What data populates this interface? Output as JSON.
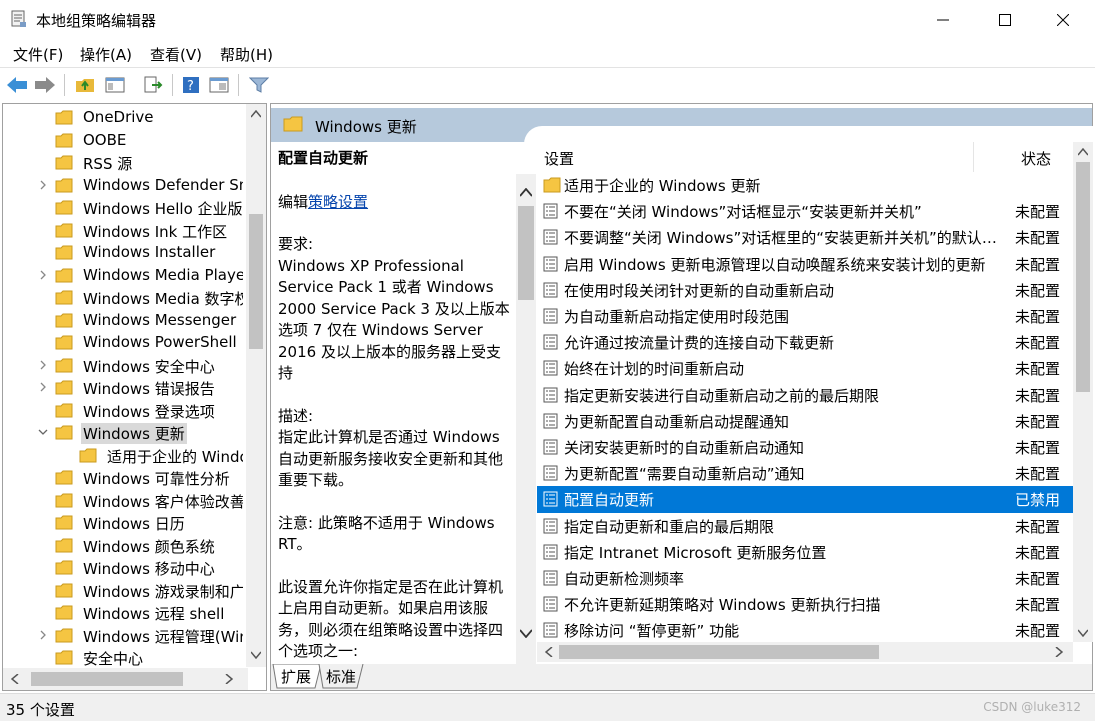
{
  "window": {
    "title": "本地组策略编辑器"
  },
  "menu": [
    "文件(F)",
    "操作(A)",
    "查看(V)",
    "帮助(H)"
  ],
  "toolbar": {
    "icons": [
      "back-icon",
      "forward-icon",
      "up-folder-icon",
      "show-hide-tree-icon",
      "export-list-icon",
      "help-icon",
      "properties-icon",
      "filter-icon"
    ]
  },
  "tree": {
    "items": [
      {
        "label": "OneDrive",
        "expandable": false,
        "indent": 0
      },
      {
        "label": "OOBE",
        "expandable": false,
        "indent": 0
      },
      {
        "label": "RSS 源",
        "expandable": false,
        "indent": 0
      },
      {
        "label": "Windows Defender SmartScreen",
        "expandable": true,
        "indent": 0
      },
      {
        "label": "Windows Hello 企业版",
        "expandable": false,
        "indent": 0
      },
      {
        "label": "Windows Ink 工作区",
        "expandable": false,
        "indent": 0
      },
      {
        "label": "Windows Installer",
        "expandable": false,
        "indent": 0
      },
      {
        "label": "Windows Media Player",
        "expandable": true,
        "indent": 0
      },
      {
        "label": "Windows Media 数字权限管理",
        "expandable": false,
        "indent": 0
      },
      {
        "label": "Windows Messenger",
        "expandable": false,
        "indent": 0
      },
      {
        "label": "Windows PowerShell",
        "expandable": false,
        "indent": 0
      },
      {
        "label": "Windows 安全中心",
        "expandable": true,
        "indent": 0
      },
      {
        "label": "Windows 错误报告",
        "expandable": true,
        "indent": 0
      },
      {
        "label": "Windows 登录选项",
        "expandable": false,
        "indent": 0
      },
      {
        "label": "Windows 更新",
        "expandable": true,
        "expanded": true,
        "selected": true,
        "indent": 0
      },
      {
        "label": "适用于企业的 Windows 更新",
        "expandable": false,
        "indent": 1
      },
      {
        "label": "Windows 可靠性分析",
        "expandable": false,
        "indent": 0
      },
      {
        "label": "Windows 客户体验改善计划",
        "expandable": false,
        "indent": 0
      },
      {
        "label": "Windows 日历",
        "expandable": false,
        "indent": 0
      },
      {
        "label": "Windows 颜色系统",
        "expandable": false,
        "indent": 0
      },
      {
        "label": "Windows 移动中心",
        "expandable": false,
        "indent": 0
      },
      {
        "label": "Windows 游戏录制和广播",
        "expandable": false,
        "indent": 0
      },
      {
        "label": "Windows 远程 shell",
        "expandable": false,
        "indent": 0
      },
      {
        "label": "Windows 远程管理(Windows Remote Management)",
        "expandable": true,
        "indent": 0
      },
      {
        "label": "安全中心",
        "expandable": false,
        "indent": 0
      }
    ]
  },
  "pane": {
    "header_title": "Windows 更新",
    "description": {
      "title": "配置自动更新",
      "edit_prefix": "编辑",
      "edit_link": "策略设置",
      "requirements_label": "要求:",
      "requirements_text": "Windows XP Professional Service Pack 1 或者 Windows 2000 Service Pack 3 及以上版本 选项 7 仅在 Windows Server 2016 及以上版本的服务器上受支持",
      "description_label": "描述:",
      "description_text": "指定此计算机是否通过 Windows 自动更新服务接收安全更新和其他重要下载。",
      "note_text": "注意: 此策略不适用于 Windows RT。",
      "detail_text": "此设置允许你指定是否在此计算机上启用自动更新。如果启用该服务，则必须在组策略设置中选择四个选项之一:"
    },
    "columns": {
      "setting": "设置",
      "state": "状态"
    },
    "rows": [
      {
        "name": "适用于企业的 Windows 更新",
        "state": "",
        "type": "folder"
      },
      {
        "name": "不要在“关闭 Windows”对话框显示“安装更新并关机”",
        "state": "未配置",
        "type": "policy"
      },
      {
        "name": "不要调整“关闭 Windows”对话框里的“安装更新并关机”的默认选项",
        "state": "未配置",
        "type": "policy"
      },
      {
        "name": "启用 Windows 更新电源管理以自动唤醒系统来安装计划的更新",
        "state": "未配置",
        "type": "policy"
      },
      {
        "name": "在使用时段关闭针对更新的自动重新启动",
        "state": "未配置",
        "type": "policy"
      },
      {
        "name": "为自动重新启动指定使用时段范围",
        "state": "未配置",
        "type": "policy"
      },
      {
        "name": "允许通过按流量计费的连接自动下载更新",
        "state": "未配置",
        "type": "policy"
      },
      {
        "name": "始终在计划的时间重新启动",
        "state": "未配置",
        "type": "policy"
      },
      {
        "name": "指定更新安装进行自动重新启动之前的最后期限",
        "state": "未配置",
        "type": "policy"
      },
      {
        "name": "为更新配置自动重新启动提醒通知",
        "state": "未配置",
        "type": "policy"
      },
      {
        "name": "关闭安装更新时的自动重新启动通知",
        "state": "未配置",
        "type": "policy"
      },
      {
        "name": "为更新配置“需要自动重新启动”通知",
        "state": "未配置",
        "type": "policy"
      },
      {
        "name": "配置自动更新",
        "state": "已禁用",
        "type": "policy",
        "selected": true
      },
      {
        "name": "指定自动更新和重启的最后期限",
        "state": "未配置",
        "type": "policy"
      },
      {
        "name": "指定 Intranet Microsoft 更新服务位置",
        "state": "未配置",
        "type": "policy"
      },
      {
        "name": "自动更新检测频率",
        "state": "未配置",
        "type": "policy"
      },
      {
        "name": "不允许更新延期策略对 Windows 更新执行扫描",
        "state": "未配置",
        "type": "policy"
      },
      {
        "name": "移除访问 “暂停更新” 功能",
        "state": "未配置",
        "type": "policy"
      }
    ],
    "tabs": [
      "扩展",
      "标准"
    ]
  },
  "status": {
    "text": "35 个设置",
    "watermark": "CSDN @luke312"
  },
  "colors": {
    "accent": "#0078d7",
    "header": "#b6c9dc",
    "folder": "#f5c542"
  }
}
